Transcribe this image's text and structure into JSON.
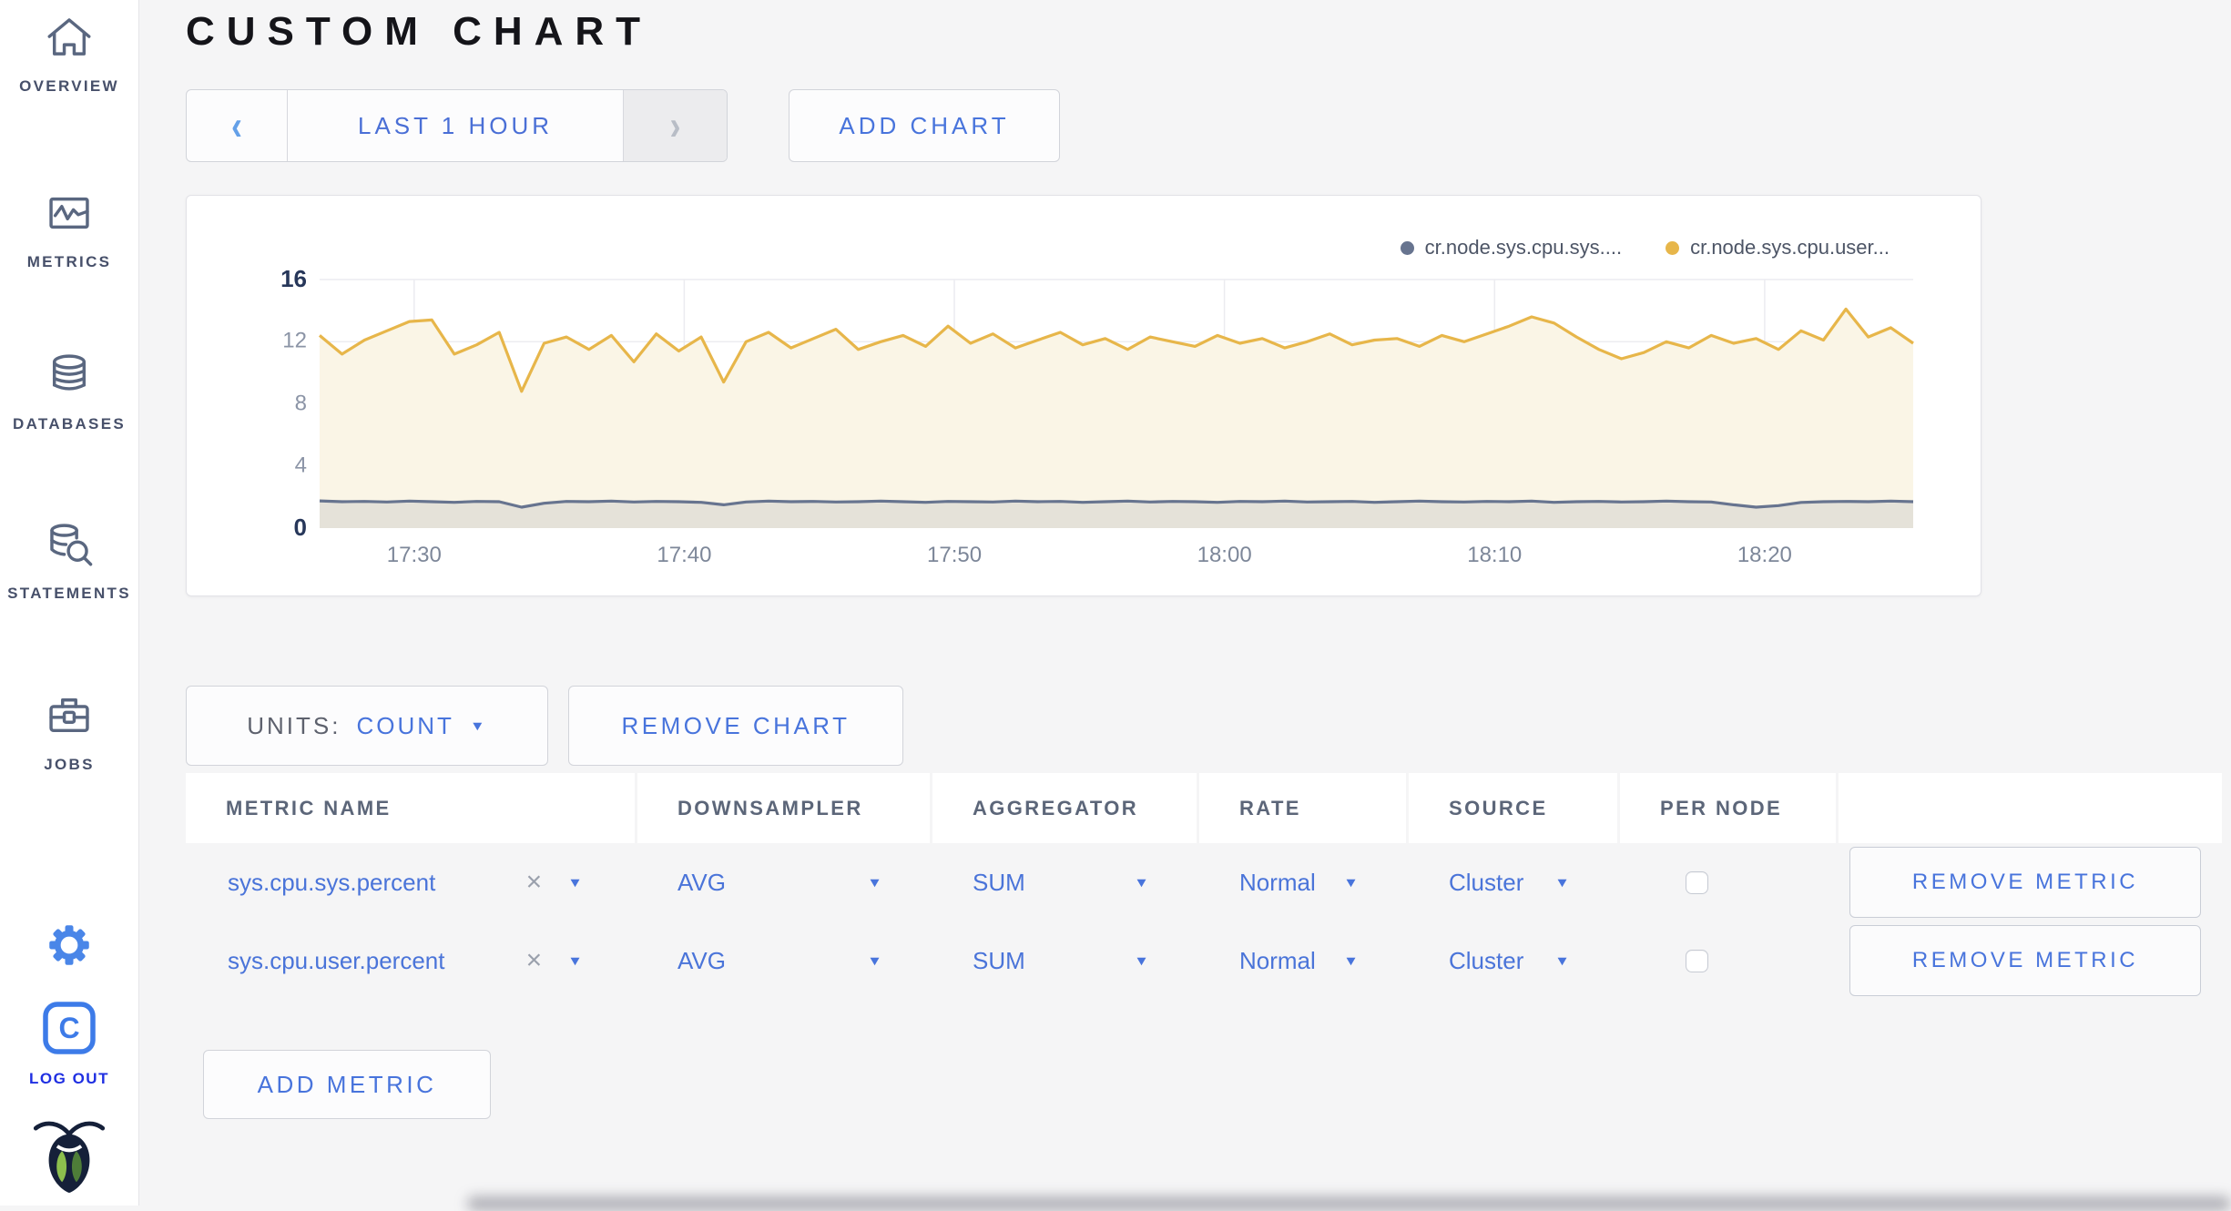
{
  "header": {
    "title": "CUSTOM CHART"
  },
  "sidebar": {
    "items": [
      {
        "label": "OVERVIEW",
        "icon": "home-icon"
      },
      {
        "label": "METRICS",
        "icon": "metrics-icon"
      },
      {
        "label": "DATABASES",
        "icon": "databases-icon"
      },
      {
        "label": "STATEMENTS",
        "icon": "statements-icon"
      },
      {
        "label": "JOBS",
        "icon": "jobs-icon"
      }
    ],
    "logout_label": "LOG OUT"
  },
  "timebar": {
    "range_label": "LAST 1 HOUR",
    "add_chart_label": "ADD CHART"
  },
  "glyphs": {
    "chevron_left": "‹",
    "chevron_right": "›",
    "caret": "▼",
    "clear": "×"
  },
  "chart_data": {
    "type": "line",
    "ylim": [
      0,
      16
    ],
    "y_ticks": [
      0,
      4,
      8,
      12,
      16
    ],
    "duration_min": 59,
    "x_ticks": [
      {
        "label": "17:30",
        "minute": 3.5
      },
      {
        "label": "17:40",
        "minute": 13.5
      },
      {
        "label": "17:50",
        "minute": 23.5
      },
      {
        "label": "18:00",
        "minute": 33.5
      },
      {
        "label": "18:10",
        "minute": 43.5
      },
      {
        "label": "18:20",
        "minute": 53.5
      }
    ],
    "grid": true,
    "legend_position": "top-right",
    "series": [
      {
        "name": "cr.node.sys.cpu.sys....",
        "color": "#67748f",
        "fill": "rgba(103,116,143,0.14)",
        "values": [
          1.75,
          1.7,
          1.72,
          1.68,
          1.74,
          1.7,
          1.66,
          1.72,
          1.7,
          1.35,
          1.6,
          1.72,
          1.7,
          1.74,
          1.68,
          1.72,
          1.7,
          1.66,
          1.5,
          1.68,
          1.74,
          1.7,
          1.72,
          1.68,
          1.7,
          1.74,
          1.7,
          1.66,
          1.72,
          1.7,
          1.68,
          1.74,
          1.7,
          1.72,
          1.66,
          1.7,
          1.74,
          1.68,
          1.72,
          1.7,
          1.66,
          1.72,
          1.7,
          1.74,
          1.68,
          1.7,
          1.72,
          1.66,
          1.7,
          1.74,
          1.7,
          1.68,
          1.72,
          1.7,
          1.74,
          1.66,
          1.7,
          1.72,
          1.68,
          1.7,
          1.74,
          1.7,
          1.68,
          1.5,
          1.35,
          1.45,
          1.65,
          1.7,
          1.72,
          1.7,
          1.74,
          1.7
        ]
      },
      {
        "name": "cr.node.sys.cpu.user...",
        "color": "#e7b64a",
        "fill": "#faf5e6",
        "values": [
          12.4,
          11.2,
          12.1,
          12.7,
          13.3,
          13.4,
          11.2,
          11.8,
          12.6,
          8.8,
          11.9,
          12.3,
          11.5,
          12.4,
          10.7,
          12.5,
          11.4,
          12.3,
          9.4,
          12.0,
          12.6,
          11.6,
          12.2,
          12.8,
          11.5,
          12.0,
          12.4,
          11.7,
          13.0,
          11.9,
          12.5,
          11.6,
          12.1,
          12.6,
          11.8,
          12.2,
          11.5,
          12.3,
          12.0,
          11.7,
          12.4,
          11.9,
          12.2,
          11.6,
          12.0,
          12.5,
          11.8,
          12.1,
          12.2,
          11.7,
          12.4,
          12.0,
          12.5,
          13.0,
          13.6,
          13.2,
          12.3,
          11.5,
          10.9,
          11.3,
          12.0,
          11.6,
          12.4,
          11.9,
          12.2,
          11.5,
          12.7,
          12.1,
          14.1,
          12.3,
          12.9,
          11.9
        ]
      }
    ]
  },
  "units": {
    "label": "UNITS:",
    "value": "COUNT"
  },
  "actions": {
    "remove_chart_label": "REMOVE CHART"
  },
  "table": {
    "headers": [
      "METRIC NAME",
      "DOWNSAMPLER",
      "AGGREGATOR",
      "RATE",
      "SOURCE",
      "PER NODE"
    ],
    "rows": [
      {
        "metric": "sys.cpu.sys.percent",
        "downsampler": "AVG",
        "aggregator": "SUM",
        "rate": "Normal",
        "source": "Cluster",
        "per_node_checked": false,
        "remove_label": "REMOVE METRIC"
      },
      {
        "metric": "sys.cpu.user.percent",
        "downsampler": "AVG",
        "aggregator": "SUM",
        "rate": "Normal",
        "source": "Cluster",
        "per_node_checked": false,
        "remove_label": "REMOVE METRIC"
      }
    ],
    "add_metric_label": "ADD METRIC"
  },
  "colors": {
    "accent_blue": "#4874dc",
    "logout_blue": "#1f2fe2",
    "gear_blue": "#4a86e8",
    "icon_slate": "#5a6780",
    "series_yellow": "#e7b64a",
    "series_slate": "#67748f",
    "page_bg": "#f5f5f6"
  }
}
